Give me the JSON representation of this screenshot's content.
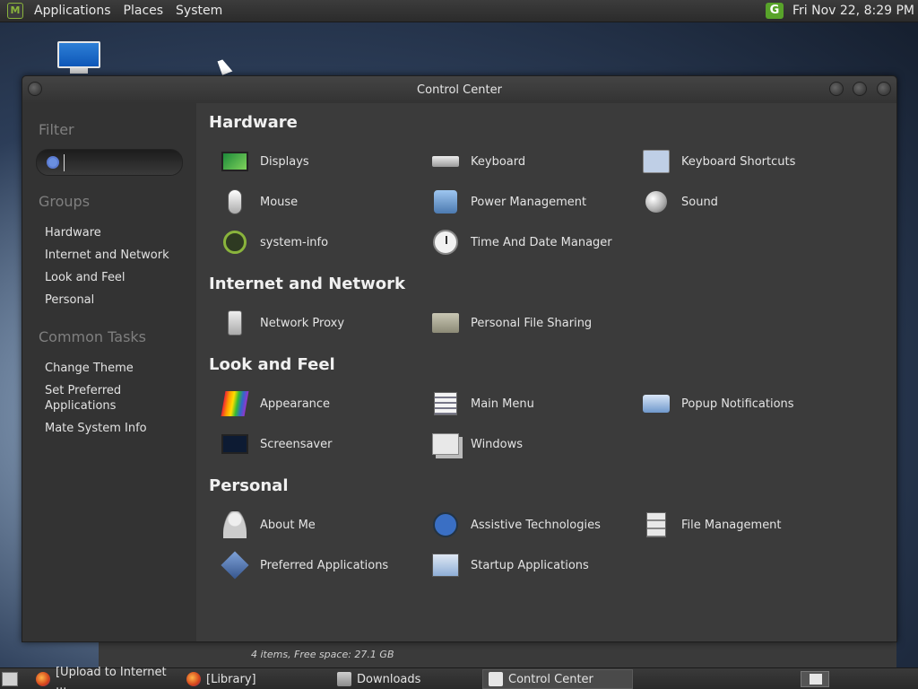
{
  "top_panel": {
    "menus": [
      "Applications",
      "Places",
      "System"
    ],
    "tray_badge": "G",
    "clock": "Fri Nov 22,  8:29 PM"
  },
  "window": {
    "title": "Control Center"
  },
  "sidebar": {
    "filter_title": "Filter",
    "search_value": "",
    "groups_title": "Groups",
    "groups": [
      "Hardware",
      "Internet and Network",
      "Look and Feel",
      "Personal"
    ],
    "tasks_title": "Common Tasks",
    "tasks": [
      "Change Theme",
      "Set Preferred Applications",
      "Mate System Info"
    ]
  },
  "sections": [
    {
      "title": "Hardware",
      "items": [
        {
          "label": "Displays",
          "icon": "display-icon"
        },
        {
          "label": "Keyboard",
          "icon": "keyboard-icon"
        },
        {
          "label": "Keyboard Shortcuts",
          "icon": "keyboard-shortcuts-icon"
        },
        {
          "label": "Mouse",
          "icon": "mouse-icon"
        },
        {
          "label": "Power Management",
          "icon": "power-icon"
        },
        {
          "label": "Sound",
          "icon": "sound-icon"
        },
        {
          "label": "system-info",
          "icon": "system-info-icon"
        },
        {
          "label": "Time And Date Manager",
          "icon": "clock-icon"
        }
      ]
    },
    {
      "title": "Internet and Network",
      "items": [
        {
          "label": "Network Proxy",
          "icon": "proxy-icon"
        },
        {
          "label": "Personal File Sharing",
          "icon": "folder-share-icon"
        }
      ]
    },
    {
      "title": "Look and Feel",
      "items": [
        {
          "label": "Appearance",
          "icon": "appearance-icon"
        },
        {
          "label": "Main Menu",
          "icon": "main-menu-icon"
        },
        {
          "label": "Popup Notifications",
          "icon": "popup-notification-icon"
        },
        {
          "label": "Screensaver",
          "icon": "screensaver-icon"
        },
        {
          "label": "Windows",
          "icon": "windows-icon"
        }
      ]
    },
    {
      "title": "Personal",
      "items": [
        {
          "label": "About Me",
          "icon": "about-me-icon"
        },
        {
          "label": "Assistive Technologies",
          "icon": "assistive-icon"
        },
        {
          "label": "File Management",
          "icon": "file-management-icon"
        },
        {
          "label": "Preferred Applications",
          "icon": "preferred-apps-icon"
        },
        {
          "label": "Startup Applications",
          "icon": "startup-apps-icon"
        }
      ]
    }
  ],
  "background_window": {
    "status": "4 items, Free space: 27.1 GB"
  },
  "taskbar": {
    "tasks": [
      {
        "label": "[Upload to Internet ...",
        "icon": "firefox-icon"
      },
      {
        "label": "[Library]",
        "icon": "firefox-icon"
      },
      {
        "label": "Downloads",
        "icon": "folder-icon"
      },
      {
        "label": "Control Center",
        "icon": "control-center-icon"
      }
    ]
  }
}
